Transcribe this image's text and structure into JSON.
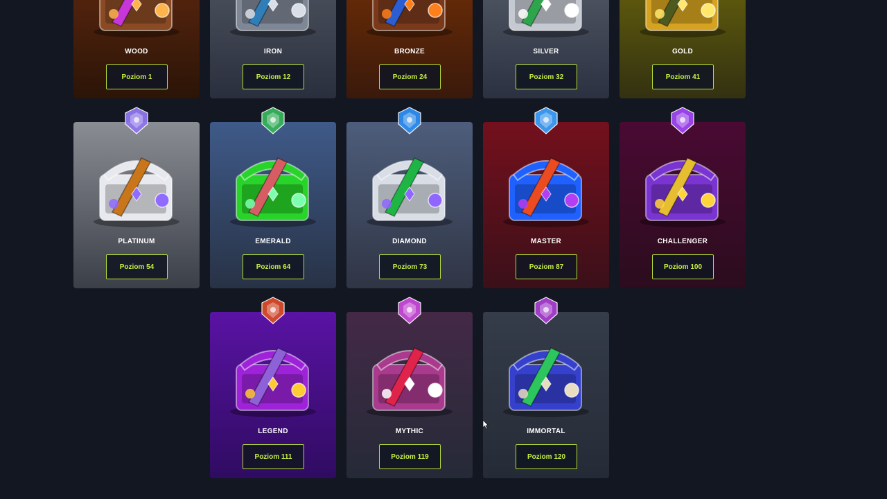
{
  "colors": {
    "background": "#131722",
    "accent": "#b8e23a",
    "button_text": "#c6ef43"
  },
  "cases": [
    {
      "name": "WOOD",
      "level": "Poziom 1",
      "bg_top": "#6b2d11",
      "bg_bottom": "#2b1407",
      "chest": "#8a4b24",
      "item": "#c636d9",
      "gem": "#ffb34d"
    },
    {
      "name": "IRON",
      "level": "Poziom 12",
      "bg_top": "#5a5f6b",
      "bg_bottom": "#2a2f3d",
      "chest": "#7e8796",
      "item": "#2f7eb7",
      "gem": "#d9dee8"
    },
    {
      "name": "BRONZE",
      "level": "Poziom 24",
      "bg_top": "#7f3405",
      "bg_bottom": "#3a190b",
      "chest": "#7a391b",
      "item": "#2c5ed2",
      "gem": "#ff7f1a"
    },
    {
      "name": "SILVER",
      "level": "Poziom 32",
      "bg_top": "#5f6673",
      "bg_bottom": "#2b3140",
      "chest": "#c5c9d1",
      "item": "#2ea44c",
      "gem": "#ffffff"
    },
    {
      "name": "GOLD",
      "level": "Poziom 41",
      "bg_top": "#76700b",
      "bg_bottom": "#333111",
      "chest": "#d5a321",
      "item": "#4d5a1f",
      "gem": "#ffe86b"
    },
    {
      "name": "PLATINUM",
      "level": "Poziom 54",
      "bg_top": "#8a8d93",
      "bg_bottom": "#3b3f48",
      "chest": "#e8e9ee",
      "item": "#c9751a",
      "gem": "#8f6bff",
      "badge": "#8f76ee"
    },
    {
      "name": "EMERALD",
      "level": "Poziom 64",
      "bg_top": "#3f5a89",
      "bg_bottom": "#283246",
      "chest": "#28d32a",
      "item": "#d65d64",
      "gem": "#7dffb0",
      "badge": "#37b35c"
    },
    {
      "name": "DIAMOND",
      "level": "Poziom 73",
      "bg_top": "#4d5d7b",
      "bg_bottom": "#303545",
      "chest": "#d8dde6",
      "item": "#1fb545",
      "gem": "#8f66ff",
      "badge": "#2e8ef0"
    },
    {
      "name": "MASTER",
      "level": "Poziom 87",
      "bg_top": "#74101d",
      "bg_bottom": "#3b1019",
      "chest": "#1f61ff",
      "item": "#ea4b20",
      "gem": "#b43ef4",
      "badge": "#3d9ef8"
    },
    {
      "name": "CHALLENGER",
      "level": "Poziom 100",
      "bg_top": "#4a0a33",
      "bg_bottom": "#2b0c1d",
      "chest": "#7a34d1",
      "item": "#e7be31",
      "gem": "#ffd43a",
      "badge": "#a046f2"
    },
    {
      "name": "LEGEND",
      "level": "Poziom 111",
      "bg_top": "#5a13a4",
      "bg_bottom": "#2f0b61",
      "chest": "#9d22d8",
      "item": "#8f61d8",
      "gem": "#ffcb33",
      "badge": "#d84c2a"
    },
    {
      "name": "MYTHIC",
      "level": "Poziom 119",
      "bg_top": "#442947",
      "bg_bottom": "#252a37",
      "chest": "#a93a8d",
      "item": "#e0234b",
      "gem": "#ffffff",
      "badge": "#c84ad9"
    },
    {
      "name": "IMMORTAL",
      "level": "Poziom 120",
      "bg_top": "#353c4a",
      "bg_bottom": "#252b36",
      "chest": "#3541cd",
      "item": "#2dc55d",
      "gem": "#e8dcc1",
      "badge": "#a83ecf"
    }
  ]
}
